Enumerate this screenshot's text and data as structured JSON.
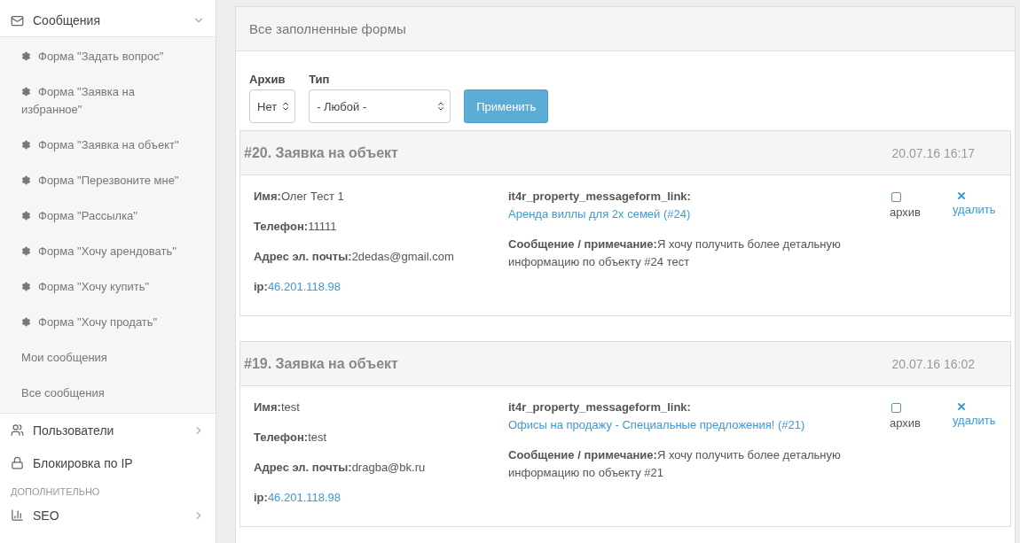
{
  "sidebar": {
    "items": [
      {
        "kind": "menu",
        "label": "Сообщения",
        "expanded": true,
        "children": [
          {
            "kind": "form",
            "label": "Форма \"Задать вопрос\""
          },
          {
            "kind": "form",
            "label": "Форма \"Заявка на избранное\""
          },
          {
            "kind": "form",
            "label": "Форма \"Заявка на объект\""
          },
          {
            "kind": "form",
            "label": "Форма \"Перезвоните мне\""
          },
          {
            "kind": "form",
            "label": "Форма \"Рассылка\""
          },
          {
            "kind": "form",
            "label": "Форма \"Хочу арендовать\""
          },
          {
            "kind": "form",
            "label": "Форма \"Хочу купить\""
          },
          {
            "kind": "form",
            "label": "Форма \"Хочу продать\""
          },
          {
            "kind": "link",
            "label": "Мои сообщения"
          },
          {
            "kind": "link",
            "label": "Все сообщения"
          }
        ]
      },
      {
        "kind": "menu",
        "label": "Пользователи",
        "expanded": false
      },
      {
        "kind": "item",
        "label": "Блокировка по IP"
      },
      {
        "kind": "section",
        "label": "ДОПОЛНИТЕЛЬНО"
      },
      {
        "kind": "menu",
        "label": "SEO",
        "expanded": false
      }
    ]
  },
  "panel": {
    "title": "Все заполненные формы",
    "filters": [
      {
        "label": "Архив",
        "value": "Нет"
      },
      {
        "label": "Тип",
        "value": "- Любой -"
      }
    ],
    "apply_button": "Применить",
    "entries": [
      {
        "title": "#20. Заявка на объект",
        "date": "20.07.16 16:17",
        "archived": false,
        "archive_label": "архив",
        "delete_label": "удалить",
        "left": [
          {
            "kind": "text",
            "label": "Имя:",
            "value": "Олег Тест 1"
          },
          {
            "kind": "text",
            "label": "Телефон:",
            "value": "11111"
          },
          {
            "kind": "text",
            "label": "Адрес эл. почты:",
            "value": "2dedas@gmail.com"
          },
          {
            "kind": "link",
            "label": "ip:",
            "value": "46.201.118.98"
          }
        ],
        "right": [
          {
            "kind": "link",
            "label": "it4r_property_messageform_link:",
            "value": "Аренда виллы для 2х семей (#24)"
          },
          {
            "kind": "text",
            "label": "Сообщение / примечание:",
            "value": "Я хочу получить более детальную информацию по объекту #24 тест"
          }
        ]
      },
      {
        "title": "#19. Заявка на объект",
        "date": "20.07.16 16:02",
        "archived": false,
        "archive_label": "архив",
        "delete_label": "удалить",
        "left": [
          {
            "kind": "text",
            "label": "Имя:",
            "value": "test"
          },
          {
            "kind": "text",
            "label": "Телефон:",
            "value": "test"
          },
          {
            "kind": "text",
            "label": "Адрес эл. почты:",
            "value": "dragba@bk.ru"
          },
          {
            "kind": "link",
            "label": "ip:",
            "value": "46.201.118.98"
          }
        ],
        "right": [
          {
            "kind": "link",
            "label": "it4r_property_messageform_link:",
            "value": "Офисы на продажу - Специальные предложения! (#21)"
          },
          {
            "kind": "text",
            "label": "Сообщение / примечание:",
            "value": "Я хочу получить более детальную информацию по объекту #21"
          }
        ]
      }
    ]
  }
}
